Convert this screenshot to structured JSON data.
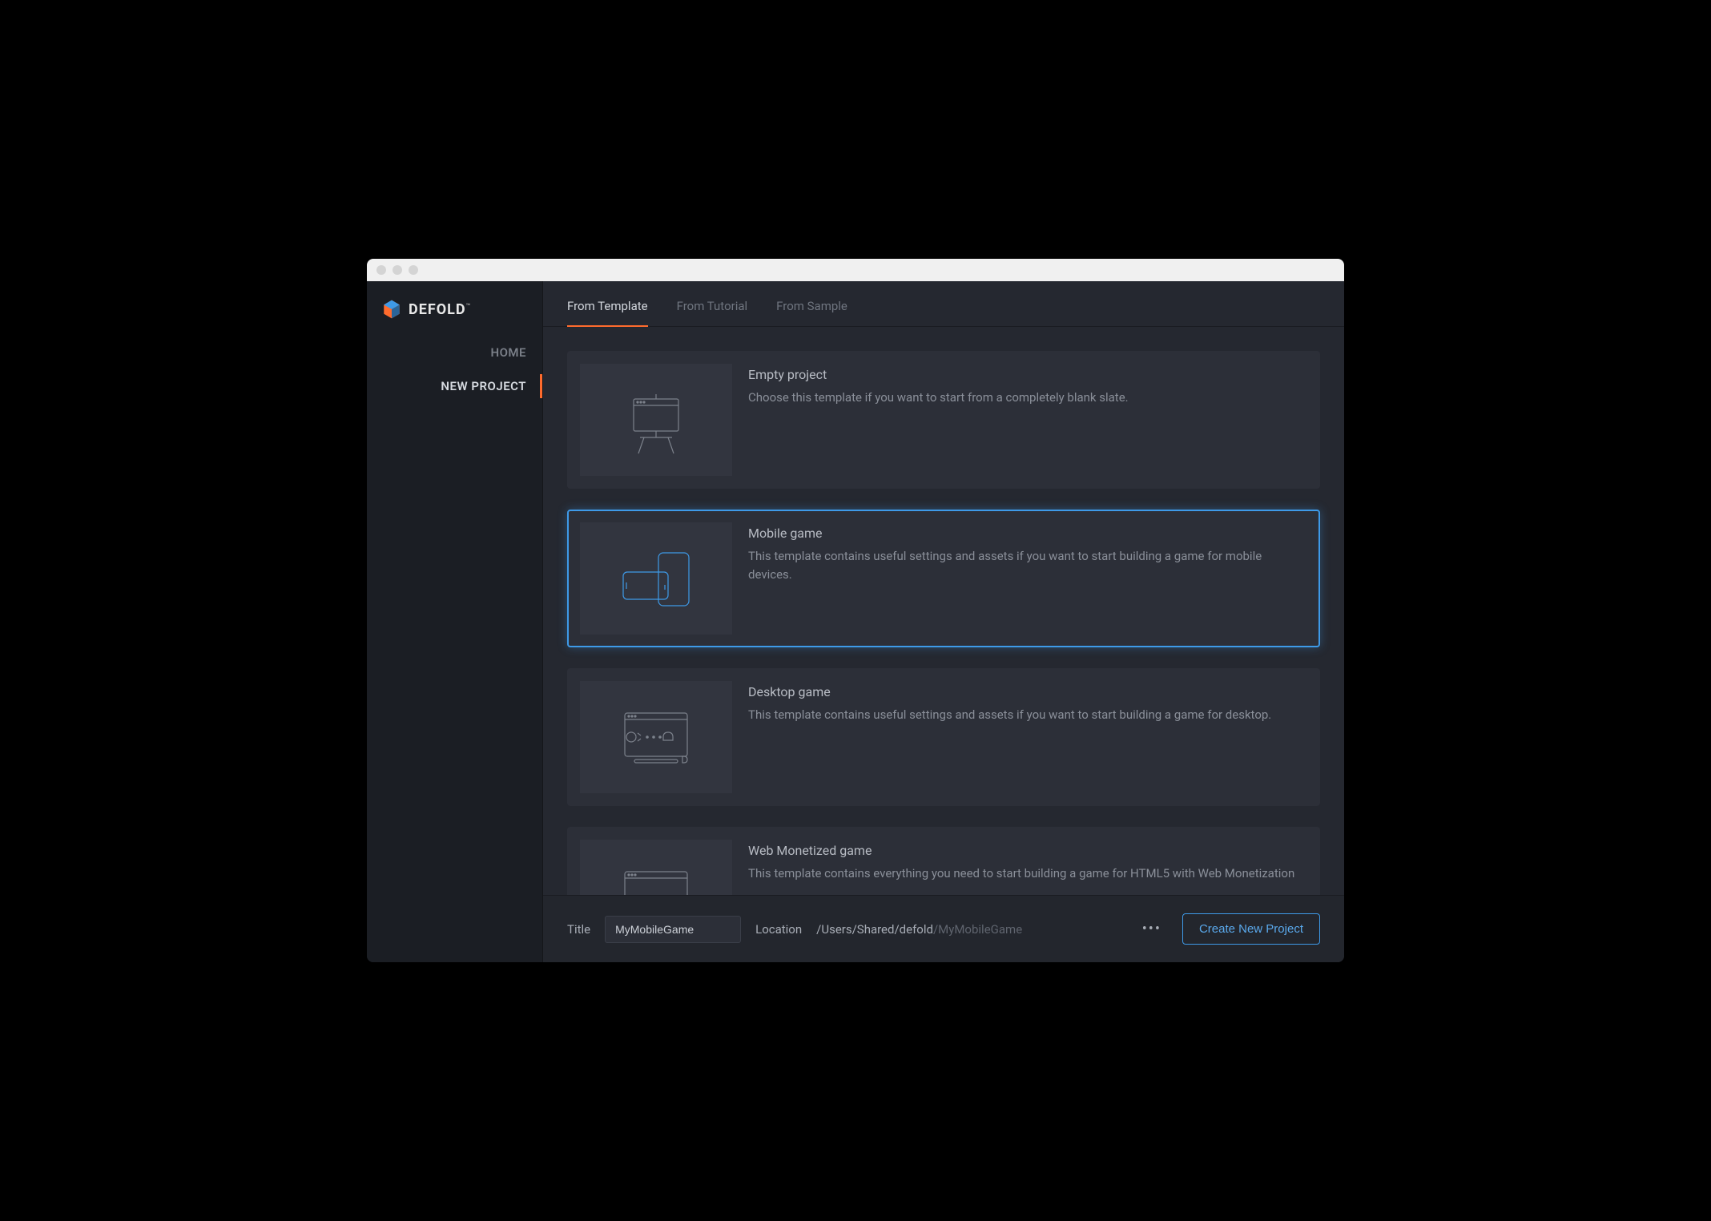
{
  "brand": {
    "name": "DEFOLD"
  },
  "sidebar": {
    "items": [
      {
        "label": "HOME",
        "active": false
      },
      {
        "label": "NEW PROJECT",
        "active": true
      }
    ]
  },
  "tabs": [
    {
      "label": "From Template",
      "active": true
    },
    {
      "label": "From Tutorial",
      "active": false
    },
    {
      "label": "From Sample",
      "active": false
    }
  ],
  "templates": [
    {
      "title": "Empty project",
      "desc": "Choose this template if you want to start from a completely blank slate.",
      "icon": "easel",
      "selected": false
    },
    {
      "title": "Mobile game",
      "desc": "This template contains useful settings and assets if you want to start building a game for mobile devices.",
      "icon": "mobile",
      "selected": true
    },
    {
      "title": "Desktop game",
      "desc": "This template contains useful settings and assets if you want to start building a game for desktop.",
      "icon": "desktop",
      "selected": false
    },
    {
      "title": "Web Monetized game",
      "desc": "This template contains everything you need to start building a game for HTML5 with Web Monetization",
      "icon": "web",
      "selected": false
    }
  ],
  "footer": {
    "title_label": "Title",
    "title_value": "MyMobileGame",
    "location_label": "Location",
    "location_path": "/Users/Shared/defold",
    "location_suffix": "/MyMobileGame",
    "more_label": "•••",
    "create_label": "Create New Project"
  }
}
